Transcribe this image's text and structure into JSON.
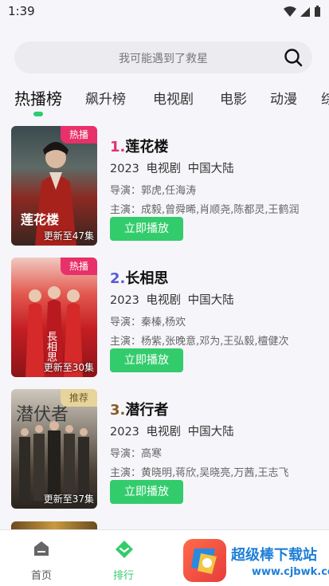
{
  "status": {
    "time": "1:39"
  },
  "search": {
    "placeholder": "我可能遇到了救星"
  },
  "tabs": [
    "热播榜",
    "飙升榜",
    "电视剧",
    "电影",
    "动漫",
    "综"
  ],
  "items": [
    {
      "rank": "1.",
      "name": "莲花楼",
      "year": "2023",
      "type": "电视剧",
      "region": "中国大陆",
      "director": "导演：郭虎,任海涛",
      "cast": "主演：成毅,曾舜晞,肖顺尧,陈都灵,王鹤润",
      "badge": "热播",
      "update": "更新至47集",
      "button": "立即播放",
      "poster_art": "莲花楼"
    },
    {
      "rank": "2.",
      "name": "长相思",
      "year": "2023",
      "type": "电视剧",
      "region": "中国大陆",
      "director": "导演：秦榛,杨欢",
      "cast": "主演：杨紫,张晚意,邓为,王弘毅,檀健次",
      "badge": "热播",
      "update": "更新至30集",
      "button": "立即播放",
      "poster_art": "長相思"
    },
    {
      "rank": "3.",
      "name": "潜行者",
      "year": "2023",
      "type": "电视剧",
      "region": "中国大陆",
      "director": "导演：高寒",
      "cast": "主演：黄晓明,蒋欣,吴晓亮,万茜,王志飞",
      "badge": "推荐",
      "update": "更新至37集",
      "button": "立即播放",
      "poster_art": "潜伏者"
    }
  ],
  "nav": {
    "home": "首页",
    "rank": "排行"
  },
  "watermark": {
    "text": "超级棒下载站",
    "url": "www.cjbwk.com"
  },
  "colors": {
    "accent": "#33cc6c",
    "rank1": "#e8306a",
    "rank2": "#5b5bd6",
    "rank3": "#8a5a2b",
    "hot_badge": "#e8306a",
    "rec_badge": "#e8d49a"
  }
}
